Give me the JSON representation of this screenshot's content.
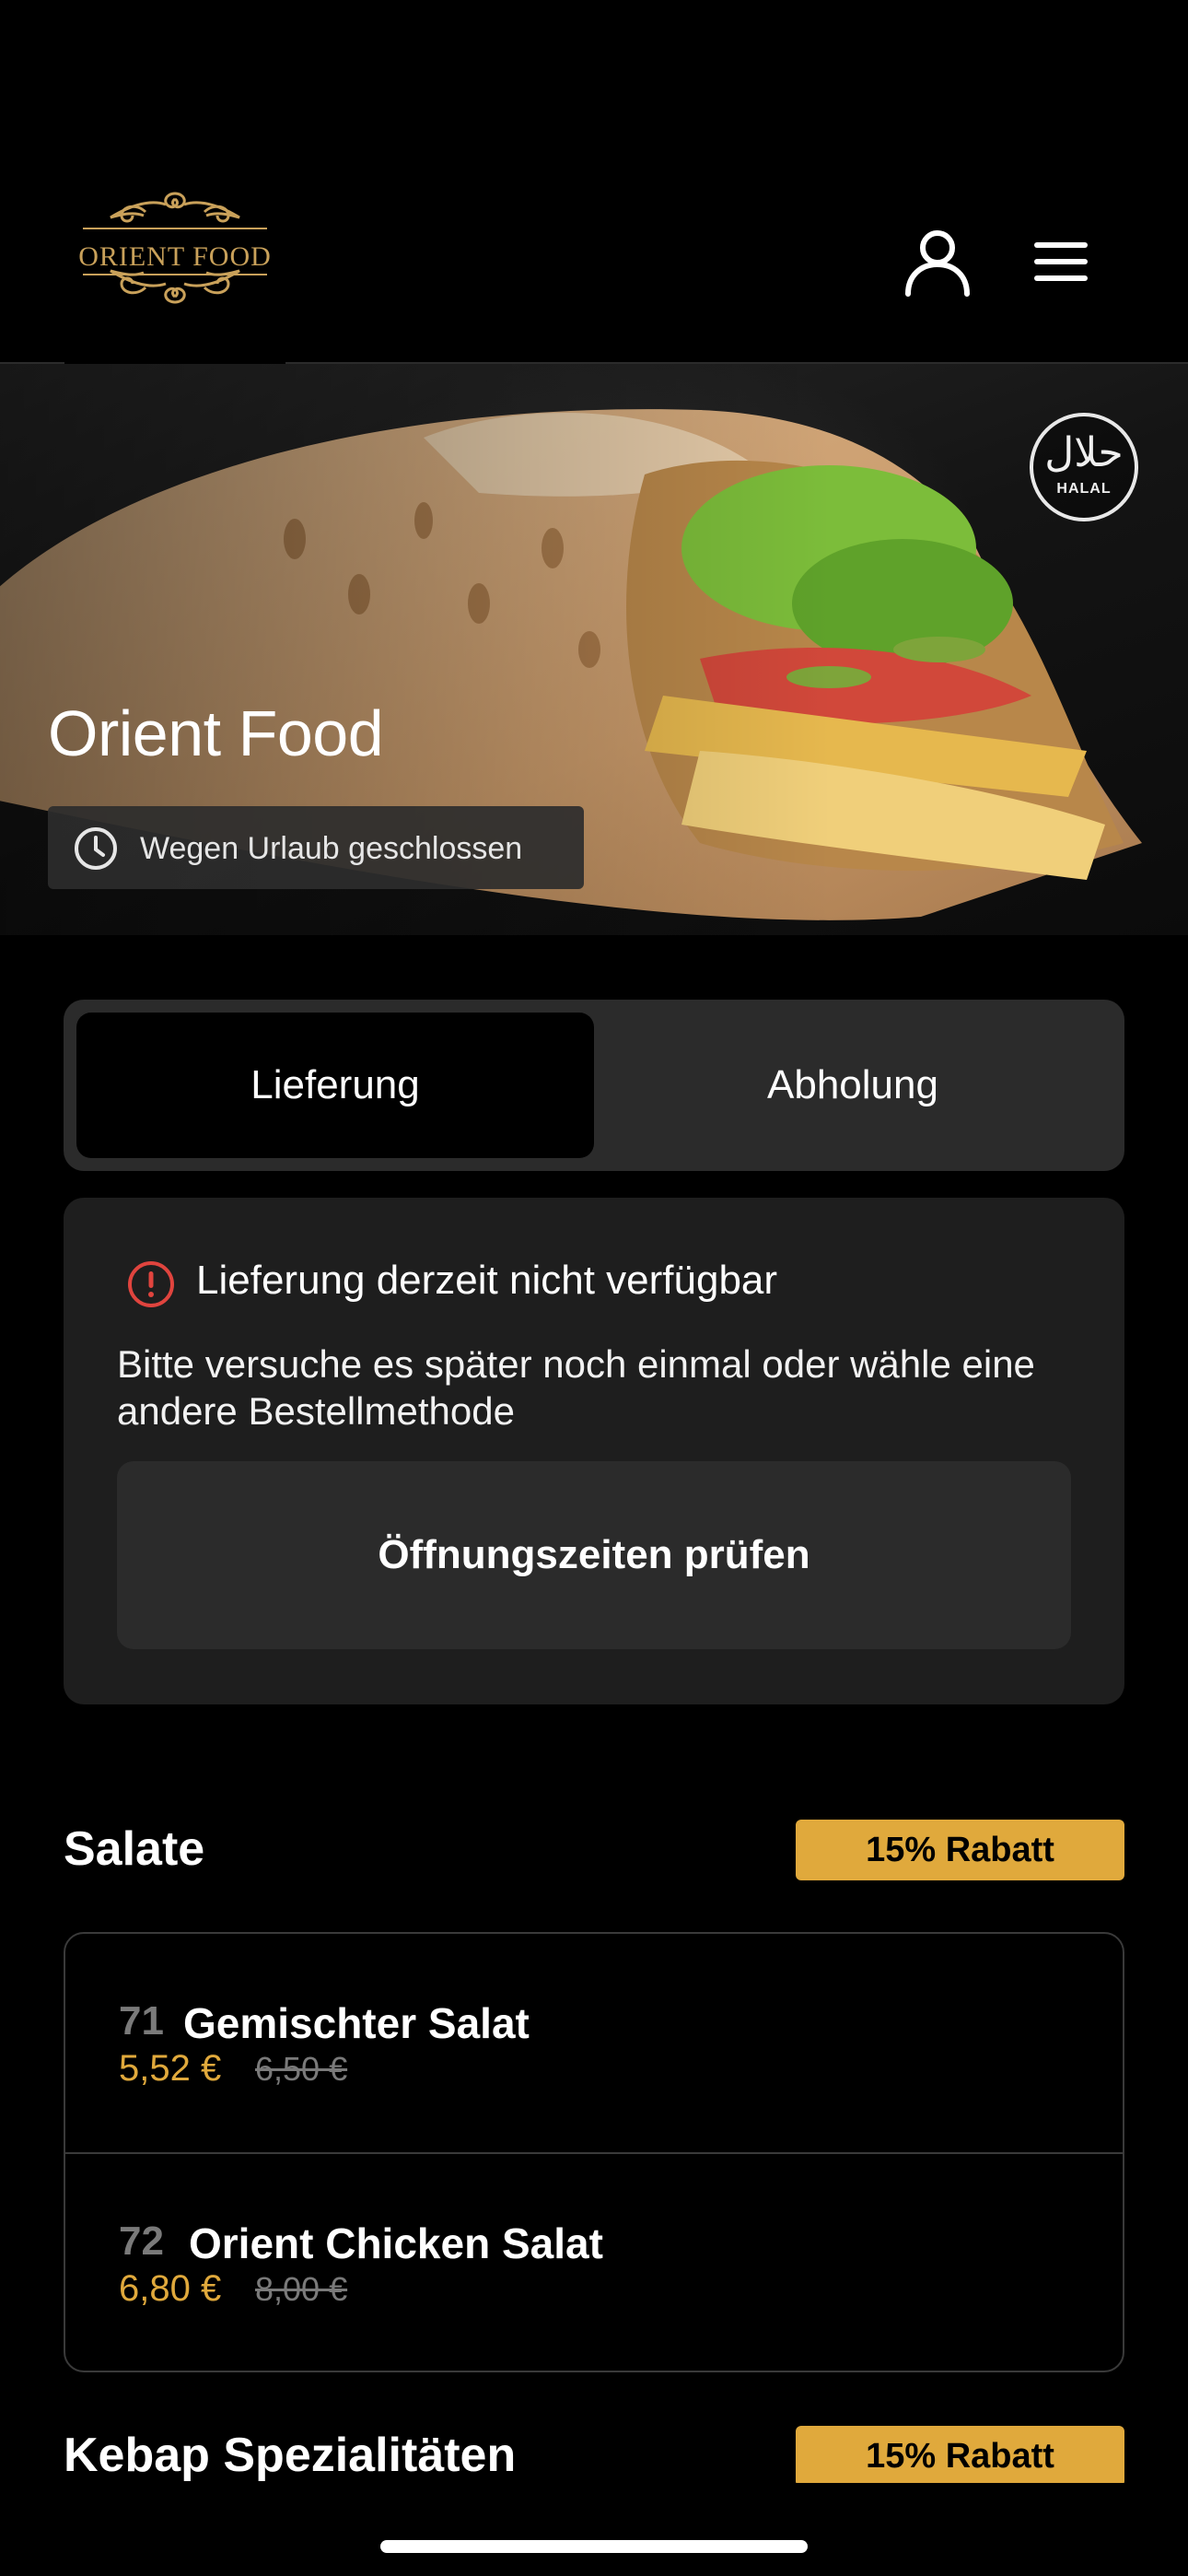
{
  "header": {
    "logo_text": "ORIENT FOOD",
    "user_icon": "user-icon",
    "menu_icon": "hamburger-menu-icon"
  },
  "hero": {
    "title": "Orient Food",
    "status": "Wegen Urlaub geschlossen",
    "status_icon": "clock-icon",
    "badge_arabic": "حلال",
    "badge_text": "HALAL"
  },
  "order_mode": {
    "options": [
      "Lieferung",
      "Abholung"
    ],
    "selected": "Lieferung"
  },
  "notice": {
    "icon": "info-circle-icon",
    "title": "Lieferung derzeit nicht verfügbar",
    "body": "Bitte versuche es später noch einmal oder wähle eine andere Bestellmethode",
    "button_label": "Öffnungszeiten prüfen"
  },
  "sections": [
    {
      "title": "Salate",
      "discount": "15% Rabatt",
      "items": [
        {
          "number": "71",
          "name": "Gemischter Salat",
          "price": "5,52 €",
          "old_price": "6,50 €"
        },
        {
          "number": "72",
          "name": "Orient Chicken Salat",
          "price": "6,80 €",
          "old_price": "8,00 €"
        }
      ]
    },
    {
      "title": "Kebap Spezialitäten",
      "discount": "15% Rabatt",
      "items": []
    }
  ],
  "colors": {
    "accent": "#e0a93c",
    "background": "#000000",
    "card": "#1e1e1e",
    "alert": "#e0443e"
  }
}
